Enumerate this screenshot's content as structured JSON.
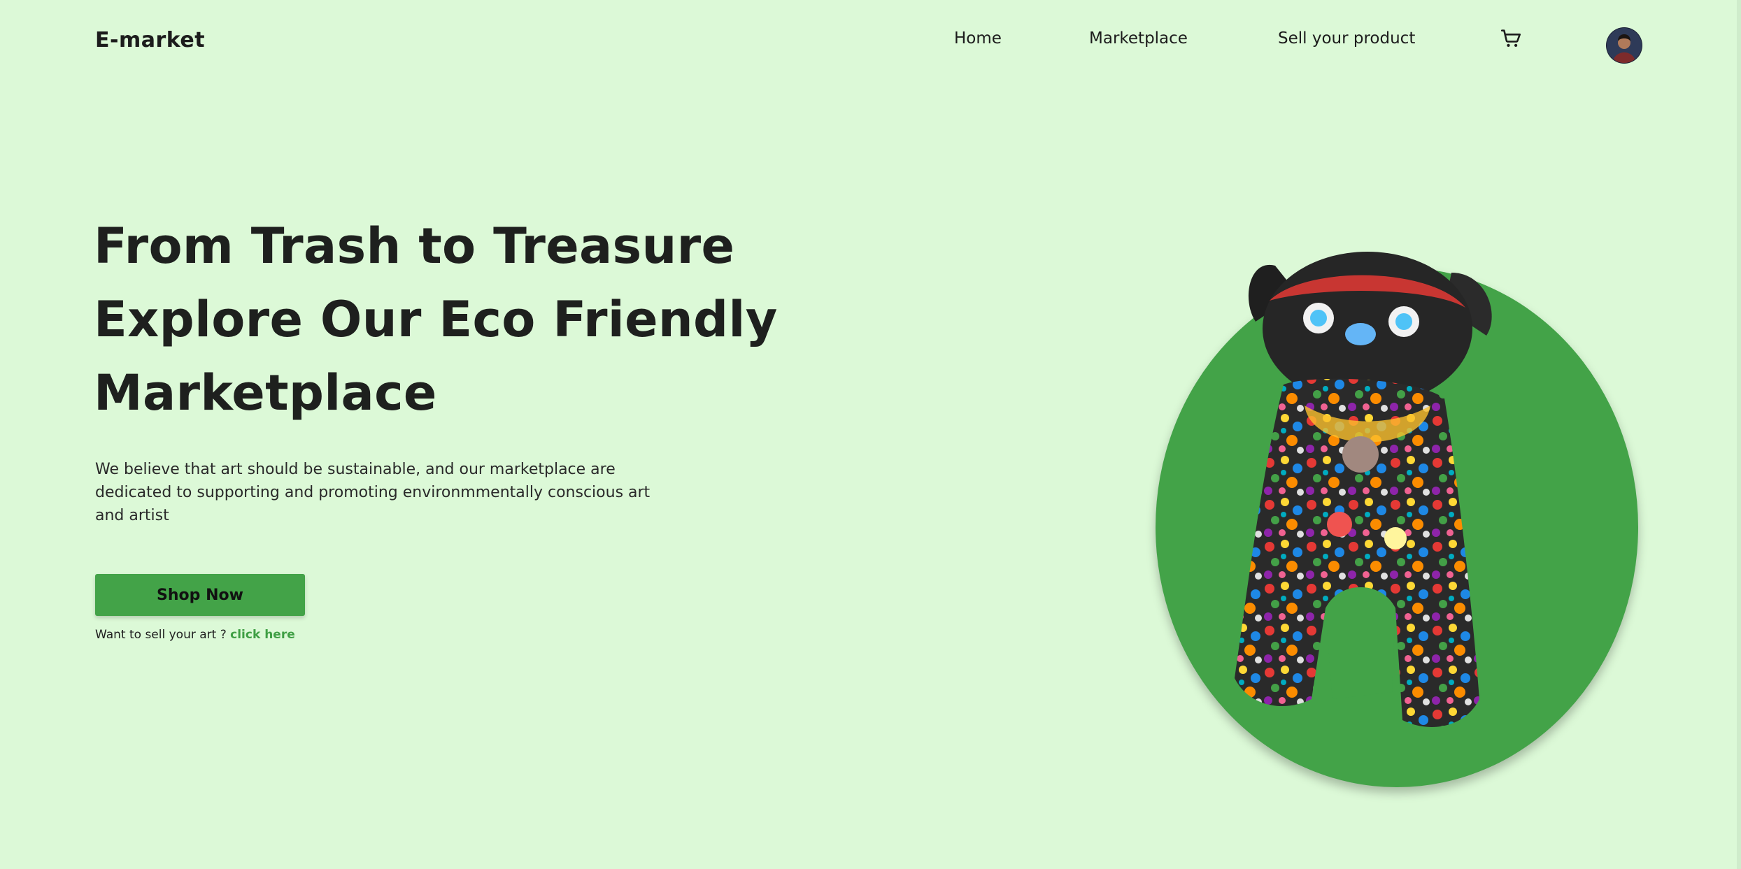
{
  "header": {
    "logo": "E-market",
    "nav": {
      "home": "Home",
      "marketplace": "Marketplace",
      "sell": "Sell your product"
    },
    "icons": {
      "cart": "shopping-cart-icon",
      "avatar": "user-avatar"
    }
  },
  "hero": {
    "title_lines": [
      "From Trash to Treasure",
      "Explore Our Eco Friendly",
      "Marketplace"
    ],
    "description": "We believe that art should be sustainable, and our marketplace are dedicated to supporting and promoting environmmentally conscious art and artist",
    "cta_label": "Shop Now",
    "sell_prompt": "Want to sell your art ? ",
    "sell_link": "click here"
  },
  "colors": {
    "background": "#dcf9d7",
    "accent": "#43a348",
    "link": "#3f9f44",
    "text": "#1e201e"
  }
}
